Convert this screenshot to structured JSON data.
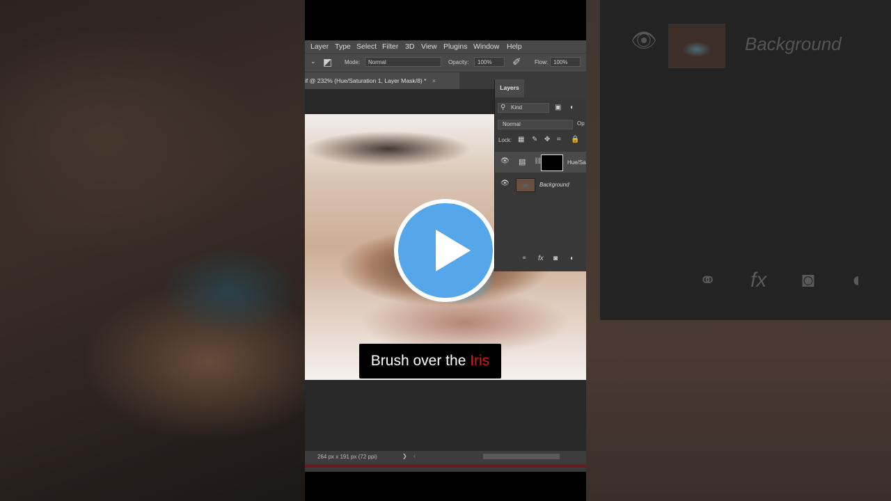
{
  "menubar": {
    "items": [
      "Layer",
      "Type",
      "Select",
      "Filter",
      "3D",
      "View",
      "Plugins",
      "Window",
      "Help"
    ]
  },
  "options_bar": {
    "mode_label": "Mode:",
    "mode_value": "Normal",
    "opacity_label": "Opacity:",
    "opacity_value": "100%",
    "flow_label": "Flow:",
    "flow_value": "100%"
  },
  "document_tab": {
    "title": "if @ 232% (Hue/Saturation 1, Layer Mask/8) *",
    "close_glyph": "×"
  },
  "layers_panel": {
    "tab_label": "Layers",
    "filter_value": "Kind",
    "blend_mode": "Normal",
    "opacity_label_partial": "Op",
    "lock_label": "Lock:",
    "layers": [
      {
        "name": "Hue/Sa",
        "type": "adjustment",
        "visible": true,
        "selected": true
      },
      {
        "name": "Background",
        "type": "image",
        "visible": true,
        "selected": false
      }
    ]
  },
  "caption": {
    "text": "Brush over the ",
    "highlight": "Iris",
    "highlight_color": "#e0141c"
  },
  "status_bar": {
    "dimensions": "264 px x 191 px (72 ppi)",
    "arrow": "❯",
    "left_arrow": "‹"
  },
  "background_panel": {
    "layer_name": "Background"
  },
  "colors": {
    "play_button": "#55a7ea",
    "app_chrome": "#494949",
    "panel": "#383838"
  }
}
